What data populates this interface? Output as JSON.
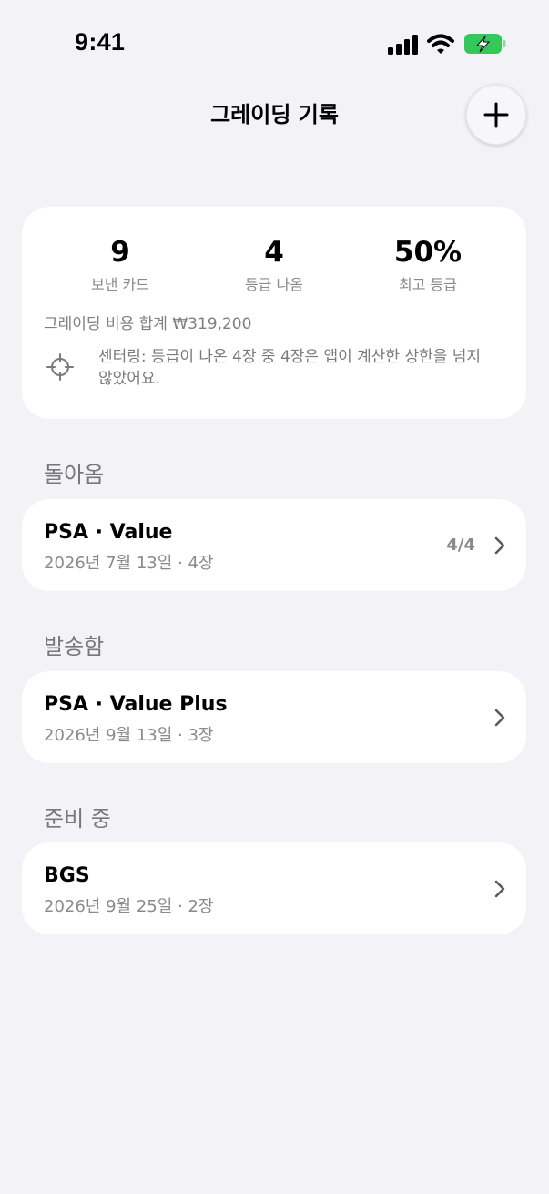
{
  "status_bar": {
    "time": "9:41"
  },
  "nav": {
    "title": "그레이딩 기록",
    "add_icon": "plus-icon"
  },
  "summary": {
    "stats": [
      {
        "value": "9",
        "label": "보낸 카드"
      },
      {
        "value": "4",
        "label": "등급 나옴"
      },
      {
        "value": "50%",
        "label": "최고 등급"
      }
    ],
    "cost_total": "그레이딩 비용 합계 ₩319,200",
    "centering_note": "센터링: 등급이 나온 4장 중 4장은 앱이 계산한 상한을 넘지 않았어요."
  },
  "sections": [
    {
      "header": "돌아옴",
      "items": [
        {
          "title": "PSA · Value",
          "subtitle": "2026년 7월 13일 · 4장",
          "count": "4/4"
        }
      ]
    },
    {
      "header": "발송함",
      "items": [
        {
          "title": "PSA · Value Plus",
          "subtitle": "2026년 9월 13일 · 3장",
          "count": ""
        }
      ]
    },
    {
      "header": "준비 중",
      "items": [
        {
          "title": "BGS",
          "subtitle": "2026년 9월 25일 · 2장",
          "count": ""
        }
      ]
    }
  ],
  "colors": {
    "battery": "#34C759",
    "background": "#F2F2F7",
    "secondary_text": "#8A8A8E"
  }
}
